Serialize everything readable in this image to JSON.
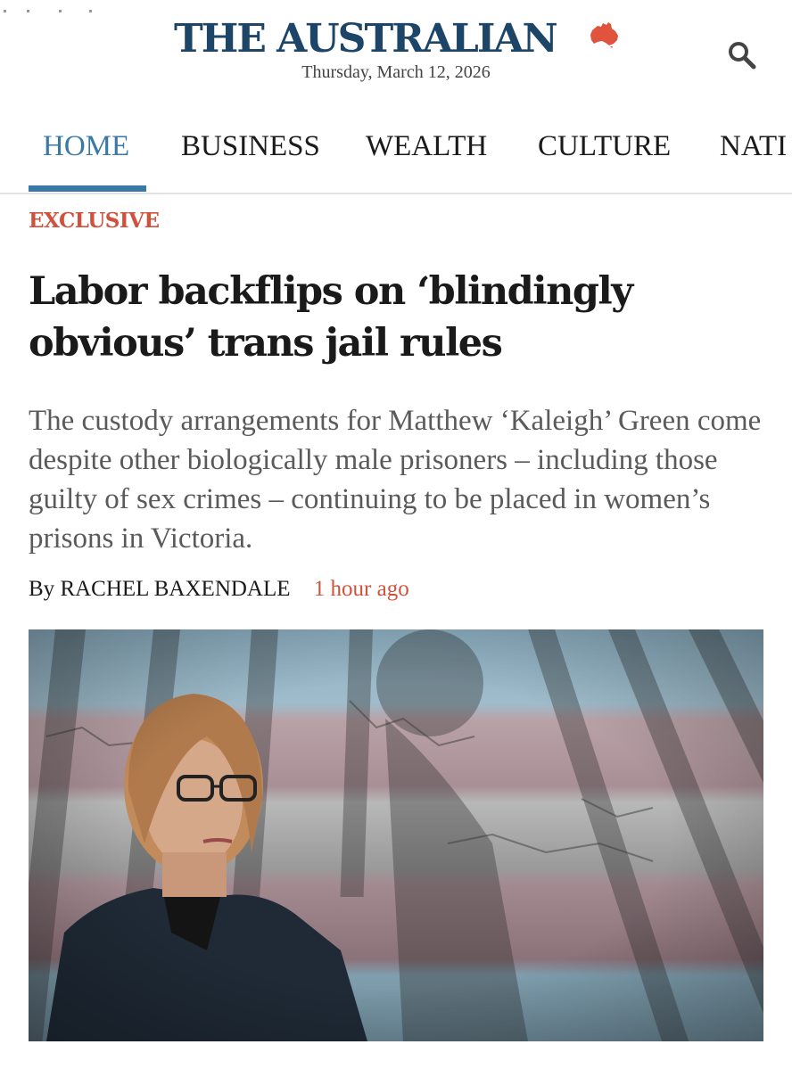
{
  "masthead": {
    "logo_text": "THE AUSTRALIAN",
    "date": "Thursday, March 12, 2026",
    "logo_color": "#1d4568",
    "map_color": "#e0533c",
    "search_icon": "search-icon"
  },
  "nav": {
    "items": [
      {
        "label": "HOME",
        "active": true
      },
      {
        "label": "BUSINESS",
        "active": false
      },
      {
        "label": "WEALTH",
        "active": false
      },
      {
        "label": "CULTURE",
        "active": false
      },
      {
        "label": "NATI",
        "active": false
      }
    ],
    "active_color": "#3a78a8"
  },
  "article": {
    "kicker": "EXCLUSIVE",
    "headline": "Labor backflips on ‘blindingly obvious’ trans jail rules",
    "standfirst": "The custody arrangements for Matthew ‘Kaleigh’ Green come despite other biologically male prisoners – including those guilty of sex crimes – continuing to be placed in women’s prisons in Victoria.",
    "byline_prefix": "By",
    "author": "RACHEL BAXENDALE",
    "time": "1 hour ago",
    "accent_color": "#d1523c"
  }
}
